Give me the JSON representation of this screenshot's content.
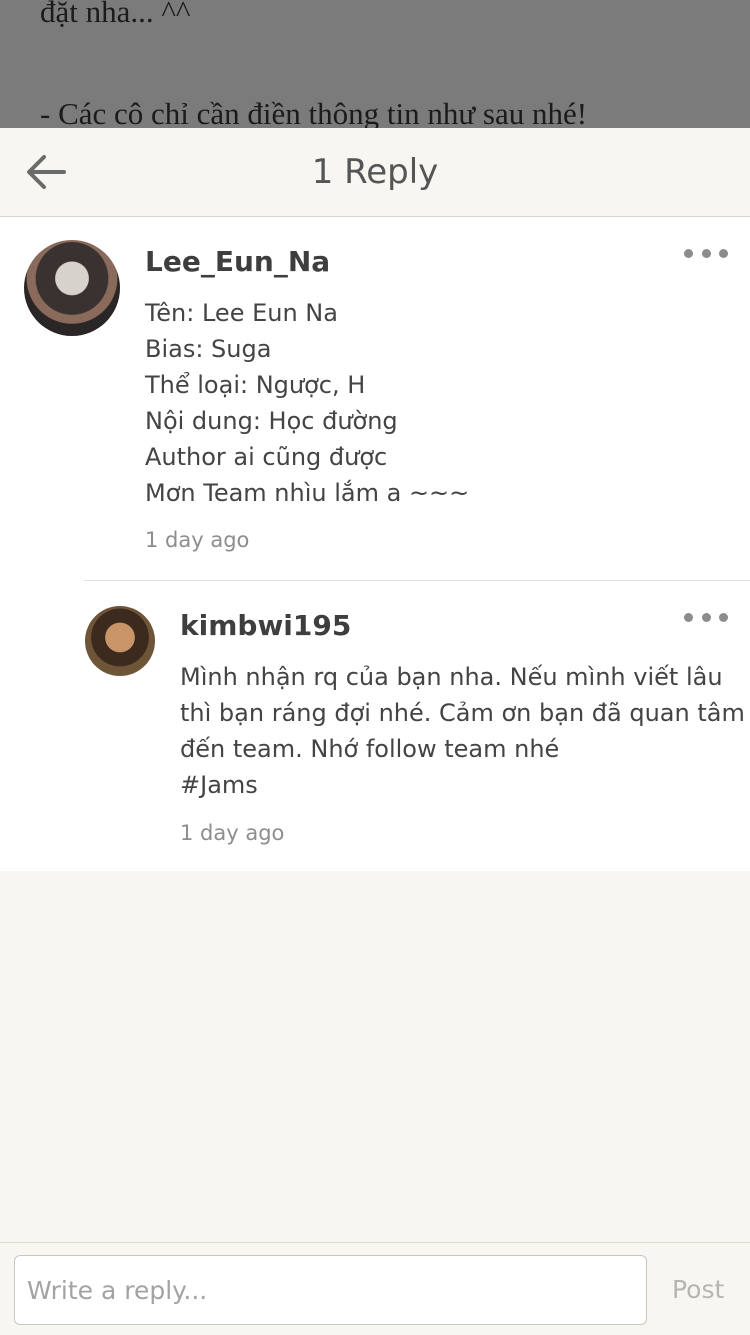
{
  "background_story": {
    "line1": "đặt nha... ^^",
    "line2": "- Các cô chỉ cần điền thông tin như sau nhé!"
  },
  "header": {
    "back_icon": "arrow-left-icon",
    "title": "1 Reply"
  },
  "comments": [
    {
      "username": "Lee_Eun_Na",
      "lines": [
        "Tên: Lee Eun Na",
        "Bias: Suga",
        "Thể loại: Ngược, H",
        "Nội dung: Học đường",
        "Author ai cũng được",
        "Mơn Team nhìu lắm a ~~~"
      ],
      "time": "1 day ago"
    },
    {
      "username": "kimbwi195",
      "lines": [
        "Mình nhận rq của bạn nha. Nếu mình viết lâu",
        "thì bạn ráng đợi nhé. Cảm ơn bạn đã quan tâm",
        "đến team. Nhớ follow team nhé",
        "#Jams"
      ],
      "time": "1 day ago"
    }
  ],
  "reply_bar": {
    "placeholder": "Write a reply...",
    "post_label": "Post"
  },
  "colors": {
    "background": "#f8f6f1",
    "panel": "#ffffff",
    "overlay": "#7b7b7b",
    "muted_text": "#8d8d8d"
  }
}
